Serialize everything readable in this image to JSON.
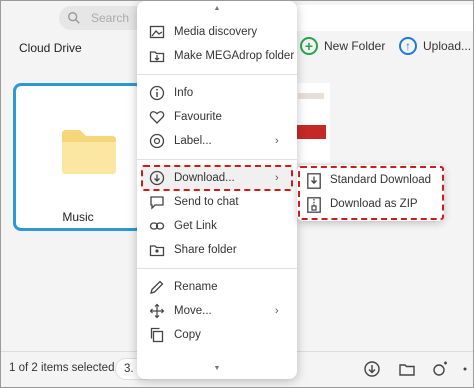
{
  "search": {
    "placeholder": "Search"
  },
  "header": {
    "title": "Cloud Drive",
    "new_folder_label": "New Folder",
    "upload_label": "Upload..."
  },
  "content": {
    "folder": {
      "name": "Music"
    }
  },
  "bottom_bar": {
    "selection_text": "1 of 2 items selected",
    "size_text": "3."
  },
  "context_menu": {
    "items": [
      {
        "label": "Media discovery",
        "icon": "media-discovery-icon"
      },
      {
        "label": "Make MEGAdrop folder",
        "icon": "megadrop-folder-icon"
      },
      {
        "label": "Info",
        "icon": "info-icon"
      },
      {
        "label": "Favourite",
        "icon": "heart-icon"
      },
      {
        "label": "Label...",
        "icon": "label-icon"
      },
      {
        "label": "Download...",
        "icon": "download-icon"
      },
      {
        "label": "Send to chat",
        "icon": "send-to-chat-icon"
      },
      {
        "label": "Get Link",
        "icon": "link-icon"
      },
      {
        "label": "Share folder",
        "icon": "share-folder-icon"
      },
      {
        "label": "Rename",
        "icon": "pencil-icon"
      },
      {
        "label": "Move...",
        "icon": "move-icon"
      },
      {
        "label": "Copy",
        "icon": "copy-icon"
      }
    ],
    "submenu_chevron": "›"
  },
  "download_submenu": {
    "items": [
      {
        "label": "Standard Download",
        "icon": "standard-download-icon"
      },
      {
        "label": "Download as ZIP",
        "icon": "zip-icon"
      }
    ]
  },
  "colors": {
    "selection_border": "#2c98d6",
    "highlight_dashed": "#d11a1a",
    "new_folder_accent": "#2ba24c",
    "upload_accent": "#1f7ad6",
    "folder_fill": "#fbe7a1"
  }
}
